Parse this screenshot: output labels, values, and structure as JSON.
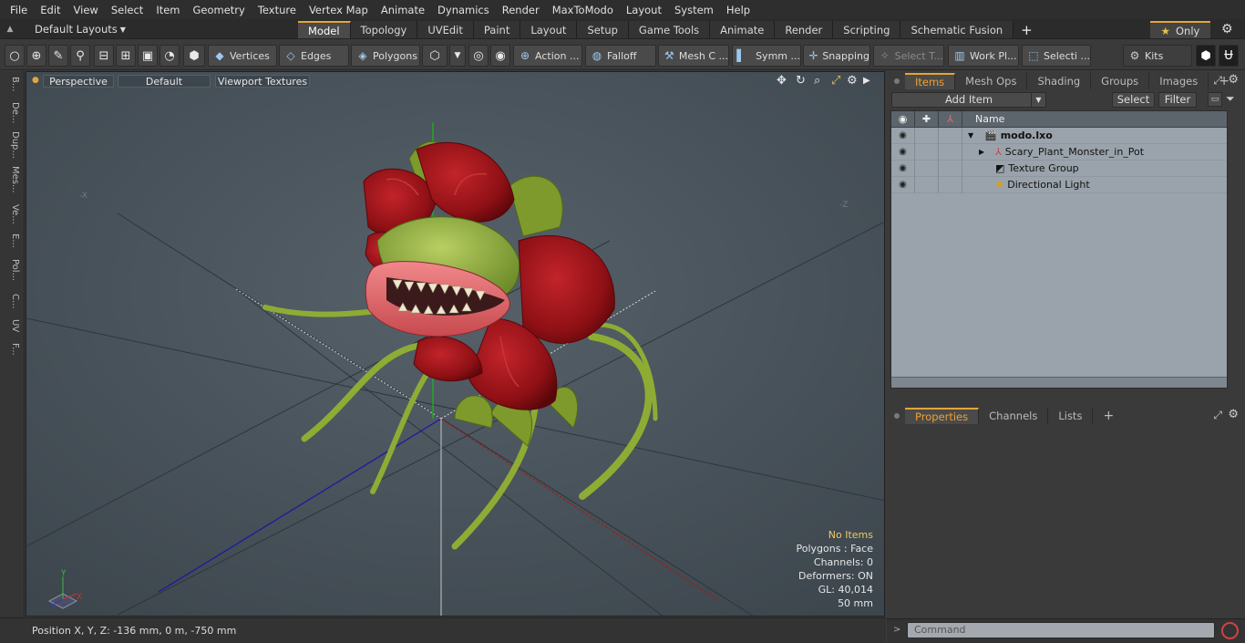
{
  "menubar": {
    "items": [
      "File",
      "Edit",
      "View",
      "Select",
      "Item",
      "Geometry",
      "Texture",
      "Vertex Map",
      "Animate",
      "Dynamics",
      "Render",
      "MaxToModo",
      "Layout",
      "System",
      "Help"
    ]
  },
  "layoutbar": {
    "layout_label": "Default Layouts",
    "tabs": [
      {
        "label": "Model",
        "active": true
      },
      {
        "label": "Topology"
      },
      {
        "label": "UVEdit"
      },
      {
        "label": "Paint"
      },
      {
        "label": "Layout"
      },
      {
        "label": "Setup"
      },
      {
        "label": "Game Tools"
      },
      {
        "label": "Animate"
      },
      {
        "label": "Render"
      },
      {
        "label": "Scripting"
      },
      {
        "label": "Schematic Fusion"
      }
    ],
    "add_tab": "+",
    "only_label": "Only"
  },
  "toolbar": {
    "vertices": "Vertices",
    "edges": "Edges",
    "polygons": "Polygons",
    "action": "Action ...",
    "falloff": "Falloff",
    "mesh": "Mesh C ...",
    "symmetry": "Symm ...",
    "snapping": "Snapping",
    "select_t": "Select T...",
    "work_plane": "Work Pl...",
    "selection": "Selecti ...",
    "kits": "Kits"
  },
  "leftstrip": {
    "tabs": [
      "B...",
      "De...",
      "Dup...",
      "Mes...",
      "Ve...",
      "E...",
      "Pol...",
      "C...",
      "UV",
      "F..."
    ]
  },
  "viewport": {
    "view_label": "Perspective",
    "shading_label": "Default",
    "texture_label": "Viewport Textures",
    "axis_labels": {
      "neg_x": "-X",
      "neg_z": "-Z",
      "y": "Y",
      "x": "X"
    },
    "stats": {
      "items": "No Items",
      "polygons": "Polygons : Face",
      "channels": "Channels: 0",
      "deformers": "Deformers: ON",
      "gl": "GL: 40,014",
      "scale": "50 mm"
    }
  },
  "statusbar": {
    "position": "Position X, Y, Z:  -136 mm, 0 m, -750 mm"
  },
  "items_panel": {
    "tabs": [
      {
        "label": "Items",
        "active": true
      },
      {
        "label": "Mesh Ops"
      },
      {
        "label": "Shading"
      },
      {
        "label": "Groups"
      },
      {
        "label": "Images"
      }
    ],
    "add_tab": "+",
    "add_item": "Add Item",
    "select": "Select",
    "filter": "Filter",
    "name_header": "Name",
    "items": [
      {
        "name": "modo.lxo",
        "bold": true,
        "indent": 0,
        "arrow": "▼"
      },
      {
        "name": "Scary_Plant_Monster_in_Pot",
        "indent": 1,
        "arrow": "▶"
      },
      {
        "name": "Texture Group",
        "indent": 1,
        "arrow": ""
      },
      {
        "name": "Directional Light",
        "indent": 1,
        "arrow": ""
      }
    ]
  },
  "props_panel": {
    "tabs": [
      {
        "label": "Properties",
        "active": true
      },
      {
        "label": "Channels"
      },
      {
        "label": "Lists"
      }
    ],
    "add_tab": "+"
  },
  "command": {
    "placeholder": "Command"
  }
}
